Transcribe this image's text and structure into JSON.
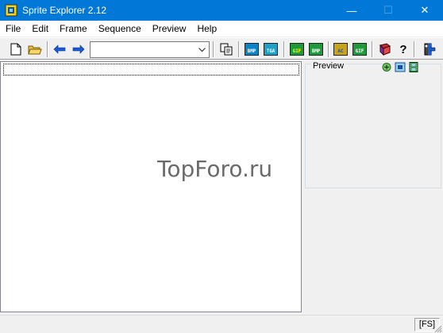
{
  "window": {
    "title": "Sprite Explorer 2.12",
    "minimize_glyph": "—",
    "maximize_glyph": "☐",
    "close_glyph": "✕"
  },
  "menu": [
    "File",
    "Edit",
    "Frame",
    "Sequence",
    "Preview",
    "Help"
  ],
  "toolbar": {
    "combo_value": "",
    "format_labels": {
      "bmp1": "BMP",
      "tga": "TGA",
      "gif1": "GIF",
      "bmp2": "BMP",
      "ac": "AC",
      "gif2": "GIF"
    },
    "help_glyph": "?"
  },
  "preview": {
    "label": "Preview"
  },
  "watermark": "TopForo.ru",
  "status": {
    "panel": "[FS]"
  },
  "colors": {
    "titlebar": "#0078d7",
    "bmp_icon": "#0a84c8",
    "tga_icon": "#1da1c8",
    "gif_icon": "#1f9a3a",
    "ac_icon": "#c8a41a"
  }
}
